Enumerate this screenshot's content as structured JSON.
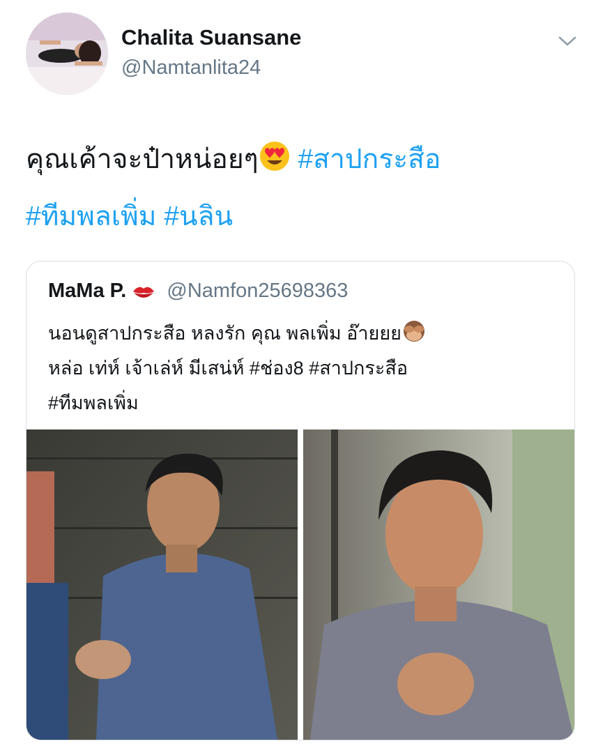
{
  "author": {
    "name": "Chalita Suansane",
    "handle": "@Namtanlita24",
    "avatar_icon": "profile-photo"
  },
  "menu": {
    "icon": "chevron-down-icon"
  },
  "tweet": {
    "text": "คุณเค้าจะป๋าหน่อยๆ",
    "emoji": "heart-eyes-emoji",
    "tags": [
      "#สาปกระสือ",
      "#ทีมพลเพิ่ม",
      "#นลิน"
    ]
  },
  "quote": {
    "name": "MaMa P.",
    "name_emoji": "kiss-mark-emoji",
    "handle": "@Namfon25698363",
    "line1": "นอนดูสาปกระสือ หลงรัก คุณ พลเพิ่ม อ๊ายยย",
    "line1_emoji": "see-no-evil-monkey-emoji",
    "line2": "หล่อ เท่ห์ เจ้าเล่ห์ มีเสน่ห์ #ช่อง8 #สาปกระสือ",
    "line3": "#ทีมพลเพิ่ม",
    "media": [
      "photo-man-blue-shirt-holding-hand",
      "photo-man-striped-shirt-clasped-hands"
    ]
  },
  "colors": {
    "link": "#1da1f2",
    "secondary": "#657786",
    "border": "#d7dde2"
  }
}
